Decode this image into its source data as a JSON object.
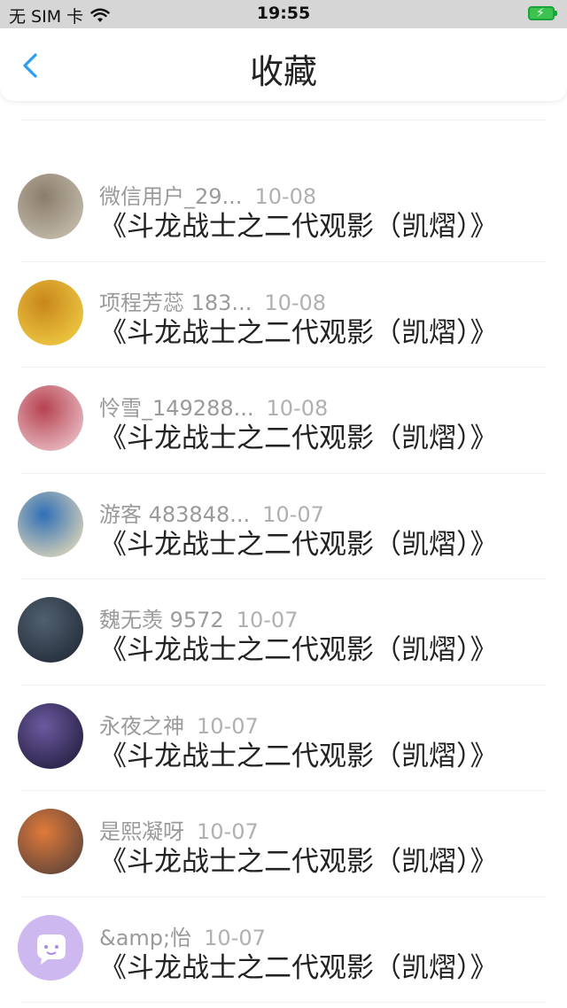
{
  "status_bar": {
    "carrier": "无 SIM 卡",
    "time": "19:55"
  },
  "nav": {
    "title": "收藏",
    "back_icon": "chevron-left-icon",
    "accent": "#2a9df4"
  },
  "items": [
    {
      "user": "",
      "date": "",
      "content": "《斗龙战士之二代观影（凯熠）》",
      "avatar_colors": [
        "#0d1a3a",
        "#3a6ea8"
      ]
    },
    {
      "user": "微信用户_29...",
      "date": "10-08",
      "content": "《斗龙战士之二代观影（凯熠）》",
      "avatar_colors": [
        "#cfc7b8",
        "#8a7d6a"
      ]
    },
    {
      "user": "项程芳蕊 183...",
      "date": "10-08",
      "content": "《斗龙战士之二代观影（凯熠）》",
      "avatar_colors": [
        "#f5d64a",
        "#c8861b"
      ]
    },
    {
      "user": "怜雪_149288...",
      "date": "10-08",
      "content": "《斗龙战士之二代观影（凯熠）》",
      "avatar_colors": [
        "#f3d5dc",
        "#b5424f"
      ]
    },
    {
      "user": "游客 483848...",
      "date": "10-07",
      "content": "《斗龙战士之二代观影（凯熠）》",
      "avatar_colors": [
        "#fbe6b8",
        "#2f6fb6"
      ]
    },
    {
      "user": "魏无羡 9572",
      "date": "10-07",
      "content": "《斗龙战士之二代观影（凯熠）》",
      "avatar_colors": [
        "#1c2430",
        "#506070"
      ]
    },
    {
      "user": "永夜之神",
      "date": "10-07",
      "content": "《斗龙战士之二代观影（凯熠）》",
      "avatar_colors": [
        "#1b1530",
        "#6a5aa0"
      ]
    },
    {
      "user": "是熙凝呀",
      "date": "10-07",
      "content": "《斗龙战士之二代观影（凯熠）》",
      "avatar_colors": [
        "#4a3c3a",
        "#e07a3a"
      ]
    },
    {
      "user": "&amp;怡",
      "date": "10-07",
      "content": "《斗龙战士之二代观影（凯熠）》",
      "avatar_colors": [
        "#cdb8f0",
        "#a98ae6"
      ]
    }
  ]
}
